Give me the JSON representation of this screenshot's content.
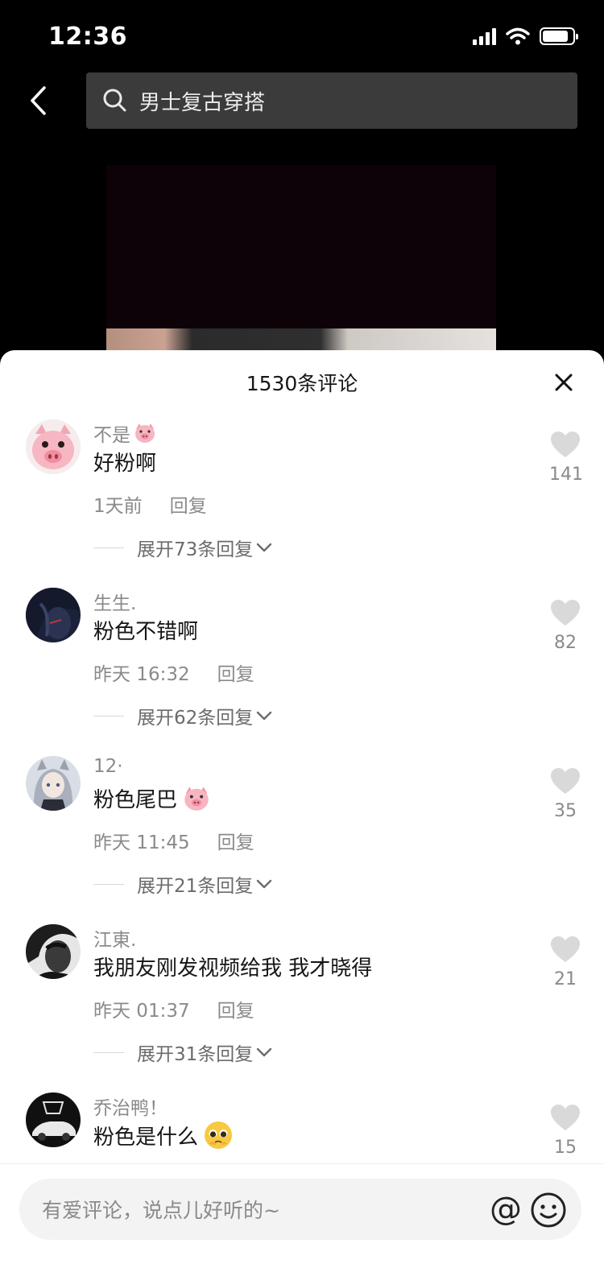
{
  "status_bar": {
    "time": "12:36",
    "battery_level": 0.85
  },
  "search": {
    "query": "男士复古穿搭",
    "icon": "search-icon"
  },
  "comments_sheet": {
    "title": "1530条评论",
    "close_icon": "close-icon",
    "comments": [
      {
        "user": "不是",
        "user_emoji": "pig-face-emoji",
        "text": "好粉啊",
        "time": "1天前",
        "reply_label": "回复",
        "expand_label": "展开73条回复",
        "likes": "141",
        "avatar": "pig-avatar"
      },
      {
        "user": "生生.",
        "text": "粉色不错啊",
        "time": "昨天 16:32",
        "reply_label": "回复",
        "expand_label": "展开62条回复",
        "likes": "82",
        "avatar": "dark-anime-avatar"
      },
      {
        "user": "12·",
        "text": "粉色尾巴",
        "text_emoji": "pig-face-emoji",
        "time": "昨天 11:45",
        "reply_label": "回复",
        "expand_label": "展开21条回复",
        "likes": "35",
        "avatar": "anime-girl-avatar"
      },
      {
        "user": "江東.",
        "text": "我朋友刚发视频给我 我才晓得",
        "time": "昨天 01:37",
        "reply_label": "回复",
        "expand_label": "展开31条回复",
        "likes": "21",
        "avatar": "man-portrait-avatar"
      },
      {
        "user": "乔治鸭！",
        "text": "粉色是什么",
        "text_emoji": "pleading-face-emoji",
        "likes": "15",
        "avatar": "gtr-car-avatar"
      }
    ]
  },
  "input": {
    "placeholder": "有爱评论，说点儿好听的~",
    "at_label": "@",
    "emoji_icon": "emoji-icon"
  },
  "colors": {
    "sheet_bg": "#ffffff",
    "search_bg": "#3b3b3b",
    "text_primary": "#161616",
    "text_secondary": "#8a8a8a",
    "like_icon": "#d9d9d9"
  }
}
